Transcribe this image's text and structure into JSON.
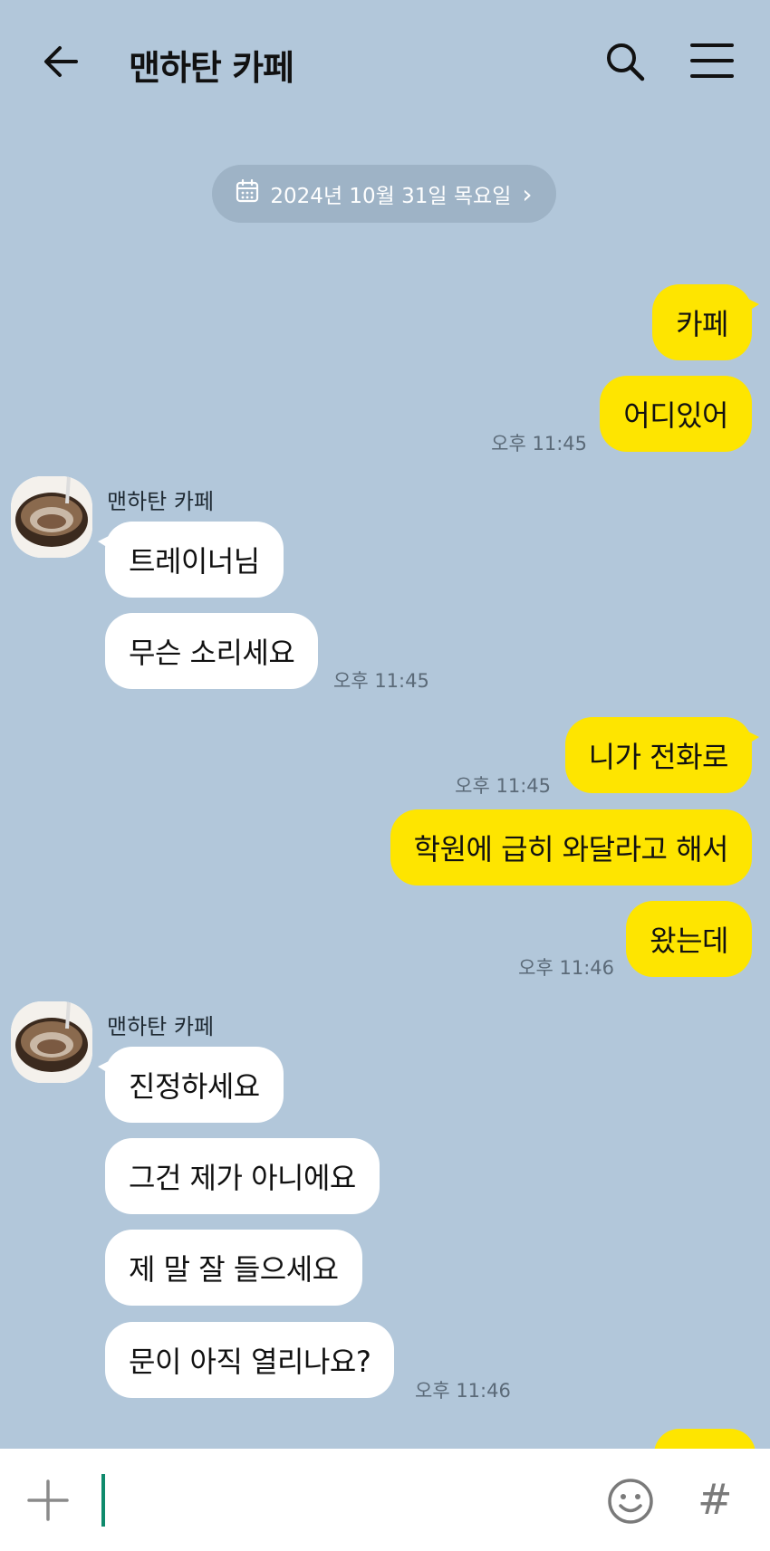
{
  "header": {
    "title": "맨하탄 카페",
    "back_icon": "back-arrow-icon",
    "search_icon": "search-icon",
    "menu_icon": "hamburger-menu-icon"
  },
  "date_divider": {
    "label": "2024년 10월 31일 목요일",
    "chevron": "›"
  },
  "messages": {
    "m1": {
      "text": "카페",
      "sender": "me"
    },
    "m2": {
      "text": "어디있어",
      "sender": "me",
      "time": "오후 11:45"
    },
    "g1": {
      "sender_name": "맨하탄 카페"
    },
    "m3": {
      "text": "트레이너님",
      "sender": "them"
    },
    "m4": {
      "text": "무슨 소리세요",
      "sender": "them",
      "time": "오후 11:45"
    },
    "m5": {
      "text": "니가 전화로",
      "sender": "me",
      "time": "오후 11:45"
    },
    "m6": {
      "text": "학원에 급히 와달라고 해서",
      "sender": "me"
    },
    "m7": {
      "text": "왔는데",
      "sender": "me",
      "time": "오후 11:46"
    },
    "g2": {
      "sender_name": "맨하탄 카페"
    },
    "m8": {
      "text": "진정하세요",
      "sender": "them"
    },
    "m9": {
      "text": "그건 제가 아니에요",
      "sender": "them"
    },
    "m10": {
      "text": "제 말 잘 들으세요",
      "sender": "them"
    },
    "m11": {
      "text": "문이 아직 열리나요?",
      "sender": "them",
      "time": "오후 11:46"
    }
  },
  "input_bar": {
    "value": "",
    "hash_label": "#"
  },
  "colors": {
    "background": "#B2C7DA",
    "my_bubble": "#FEE500",
    "their_bubble": "#FFFFFF",
    "time_text": "#5B6A78",
    "cursor": "#0F8A6C"
  }
}
